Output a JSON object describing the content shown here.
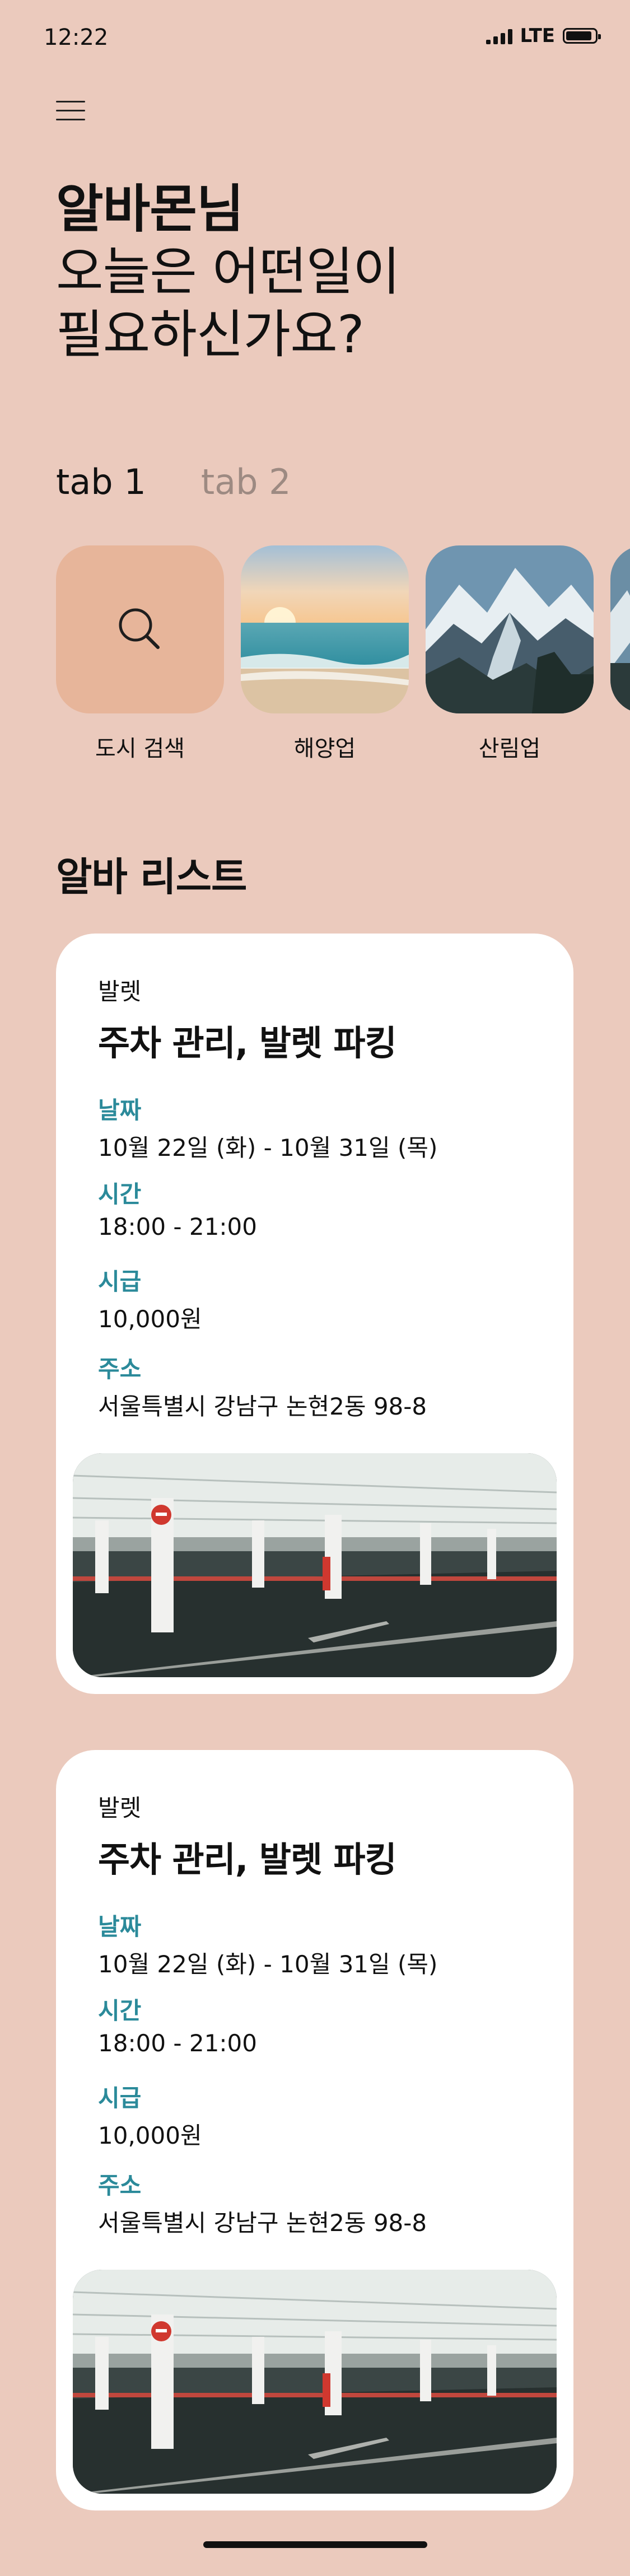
{
  "status_bar": {
    "time": "12:22",
    "network": "LTE"
  },
  "greeting": {
    "name": "알바몬님",
    "line1": "오늘은 어떤일이",
    "line2": "필요하신가요?"
  },
  "tabs": [
    {
      "label": "tab 1",
      "active": true
    },
    {
      "label": "tab 2",
      "active": false
    }
  ],
  "categories": [
    {
      "label": "도시 검색",
      "icon": "search-icon"
    },
    {
      "label": "해양업",
      "icon": "beach-image"
    },
    {
      "label": "산림업",
      "icon": "mountain-image"
    },
    {
      "label": "",
      "icon": "partial-image"
    }
  ],
  "section_title": "알바 리스트",
  "jobs": [
    {
      "category": "발렛",
      "title": "주차 관리, 발렛 파킹",
      "date_label": "날짜",
      "date_value": "10월 22일 (화) - 10월 31일 (목)",
      "time_label": "시간",
      "time_value": "18:00 - 21:00",
      "wage_label": "시급",
      "wage_value": "10,000원",
      "address_label": "주소",
      "address_value": "서울특별시 강남구 논현2동 98-8",
      "image": "parking-garage-image"
    },
    {
      "category": "발렛",
      "title": "주차 관리, 발렛 파킹",
      "date_label": "날짜",
      "date_value": "10월 22일 (화) - 10월 31일 (목)",
      "time_label": "시간",
      "time_value": "18:00 - 21:00",
      "wage_label": "시급",
      "wage_value": "10,000원",
      "address_label": "주소",
      "address_value": "서울특별시 강남구 논현2동 98-8",
      "image": "parking-garage-image"
    }
  ],
  "colors": {
    "background": "#ebcabd",
    "accent_label": "#2b8a9a",
    "search_tile": "#e7b59a"
  }
}
